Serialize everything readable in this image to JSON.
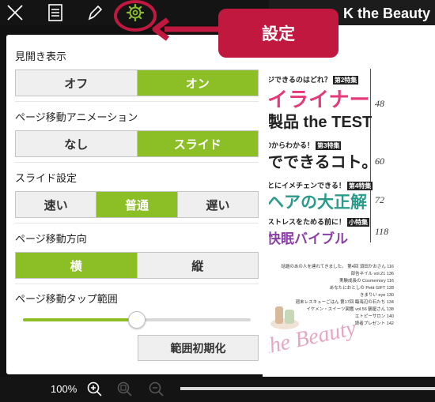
{
  "magazine": {
    "header_title": "K the Beauty",
    "toc": [
      {
        "kicker": "ジできるのはどれ？",
        "badge": "第2特集",
        "title": "イライナー",
        "title2": "製品 the TEST",
        "page": "48"
      },
      {
        "kicker": "0からわかる！",
        "badge": "第3特集",
        "title": "でできるコト。",
        "page": "60"
      },
      {
        "kicker": "とにイメチェンできる！",
        "badge": "第4特集",
        "title": "ヘアの大正解",
        "page": "72"
      },
      {
        "kicker": "ストレスをためる前に！",
        "badge": "小特集",
        "title": "快眠バイブル",
        "page": "118"
      }
    ],
    "small_list": [
      "話題のあの人を連れてきました。 第4回 須田かおさん 116",
      "部告ネイル vol.21 136",
      "実験成長の Cosmemory 116",
      "あなたにおとしの Petit GIFT 128",
      "きまりい eye 130",
      "週末レスキューごはん 第17回 臨海辺の石たち 134",
      "イケメン・スイーツ図鑑 vol.56 鶴屋さん 138",
      "エトピーサロン 140",
      "読者プレゼント 142"
    ],
    "cursive_logo": "the Beauty"
  },
  "toolbar": {
    "icons": [
      "close-icon",
      "toc-list-icon",
      "pen-icon",
      "gear-icon"
    ]
  },
  "settings": {
    "spread": {
      "label": "見開き表示",
      "options": [
        "オフ",
        "オン"
      ],
      "selected": 1
    },
    "page_animation": {
      "label": "ページ移動アニメーション",
      "options": [
        "なし",
        "スライド"
      ],
      "selected": 1
    },
    "slide_setting": {
      "label": "スライド設定",
      "options": [
        "速い",
        "普通",
        "遅い"
      ],
      "selected": 1
    },
    "page_direction": {
      "label": "ページ移動方向",
      "options": [
        "横",
        "縦"
      ],
      "selected": 0
    },
    "tap_range": {
      "label": "ページ移動タップ範囲",
      "value": 0.5
    },
    "reset_label": "範囲初期化"
  },
  "bottom_bar": {
    "zoom_level": "100%",
    "icons": [
      "zoom-in-icon",
      "zoom-reset-icon",
      "zoom-out-icon"
    ]
  },
  "annotation": {
    "callout_text": "設定"
  },
  "colors": {
    "accent": "#8cbf26",
    "annotation": "#c0183e",
    "toolbar_bg": "#141414"
  }
}
